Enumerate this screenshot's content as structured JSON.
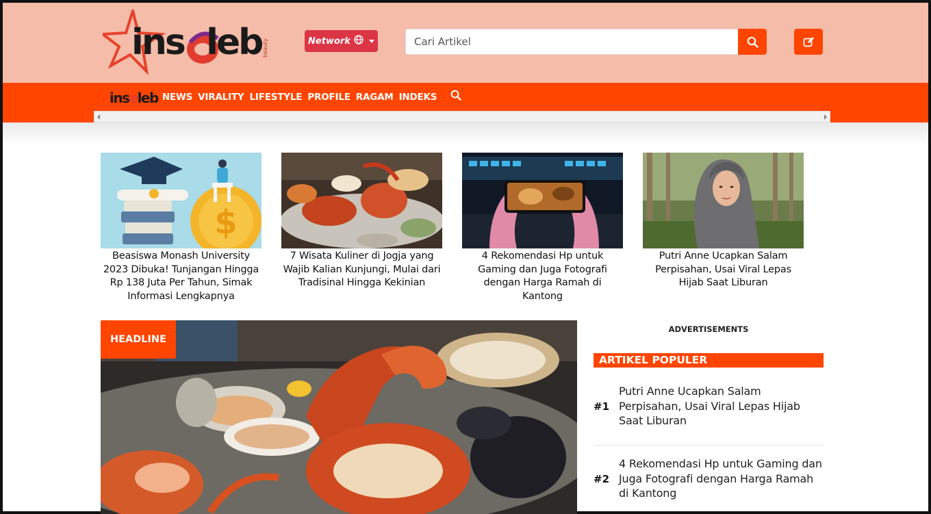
{
  "brand": {
    "name": "inseleb",
    "name_start": "ins",
    "name_mid": "e",
    "name_end": "leb",
    "tagline": "beauty",
    "accent_color": "#ff4500",
    "header_bg": "#f4bca9"
  },
  "header": {
    "network_label": "Network",
    "search_placeholder": "Cari Artikel"
  },
  "nav": {
    "items": [
      "NEWS",
      "VIRALITY",
      "LIFESTYLE",
      "PROFILE",
      "RAGAM",
      "INDEKS"
    ]
  },
  "cards": [
    {
      "title": "Beasiswa Monash University 2023 Dibuka! Tunjangan Hingga Rp 138 Juta Per Tahun, Simak Informasi Lengkapnya",
      "image": "scholarship-illustration"
    },
    {
      "title": "7 Wisata Kuliner di Jogja yang Wajib Kalian Kunjungi, Mulai dari Tradisinal Hingga Kekinian",
      "image": "seafood-platter-photo"
    },
    {
      "title": "4 Rekomendasi Hp untuk Gaming dan Juga Fotografi dengan Harga Ramah di Kantong",
      "image": "mobile-gaming-photo"
    },
    {
      "title": "Putri Anne Ucapkan Salam Perpisahan, Usai Viral Lepas Hijab Saat Liburan",
      "image": "hijab-woman-photo"
    }
  ],
  "headline": {
    "tag": "HEADLINE",
    "image": "seafood-lobster-photo"
  },
  "sidebar": {
    "ads_label": "ADVERTISEMENTS",
    "popular_title": "ARTIKEL POPULER",
    "popular": [
      {
        "rank": "#1",
        "title": "Putri Anne Ucapkan Salam Perpisahan, Usai Viral Lepas Hijab Saat Liburan"
      },
      {
        "rank": "#2",
        "title": "4 Rekomendasi Hp untuk Gaming dan Juga Fotografi dengan Harga Ramah di Kantong"
      }
    ]
  },
  "icons": {
    "globe": "globe-icon",
    "search": "search-icon",
    "write": "pencil-square-icon"
  }
}
